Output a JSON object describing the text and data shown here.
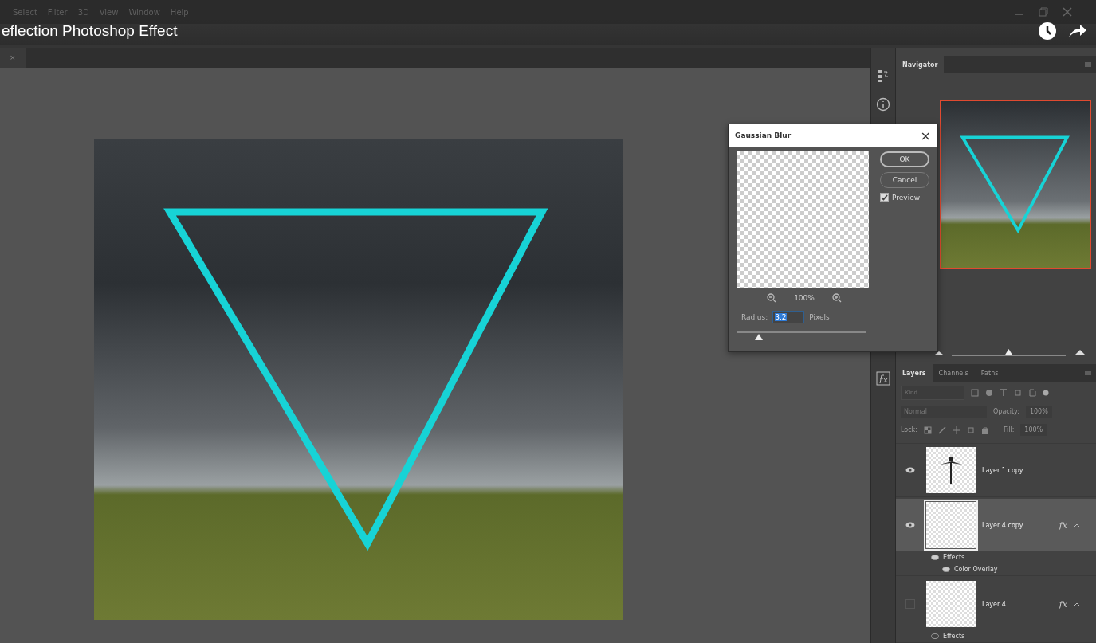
{
  "video_title": "eflection Photoshop Effect",
  "menu": [
    "Select",
    "Filter",
    "3D",
    "View",
    "Window",
    "Help"
  ],
  "document_tab": {
    "close": "×"
  },
  "dialog": {
    "title": "Gaussian Blur",
    "close": "×",
    "zoom": "100%",
    "buttons": [
      {
        "label": "OK",
        "selected": true
      },
      {
        "label": "Cancel",
        "selected": false
      }
    ],
    "preview": {
      "label": "Preview",
      "checked": true
    },
    "radius": {
      "label": "Radius:",
      "value": "3.2",
      "unit": "Pixels",
      "level": 0.17
    }
  },
  "navigator": {
    "title": "Navigator",
    "level": 0.5
  },
  "layers_panel": {
    "tabs": [
      {
        "label": "Layers",
        "selected": true
      },
      {
        "label": "Channels",
        "selected": false
      },
      {
        "label": "Paths",
        "selected": false
      }
    ],
    "filter_placeholder": "Kind",
    "blend_mode": "Normal",
    "opacity_label": "Opacity:",
    "opacity": "100%",
    "lock_label": "Lock:",
    "fill_label": "Fill:",
    "fill": "100%",
    "layers": [
      {
        "name": "Layer 1 copy",
        "kind": "figure",
        "visible": true,
        "selected": false
      },
      {
        "name": "Layer 4 copy",
        "kind": "empty",
        "visible": true,
        "selected": true,
        "fx": "fx",
        "effects": [
          {
            "label": "Effects",
            "visible": true,
            "children": [
              {
                "label": "Color Overlay",
                "visible": true
              }
            ]
          }
        ]
      },
      {
        "name": "Layer 4",
        "kind": "empty",
        "visible": false,
        "selected": false,
        "fx": "fx",
        "effects": [
          {
            "label": "Effects",
            "visible": false
          }
        ]
      }
    ]
  }
}
